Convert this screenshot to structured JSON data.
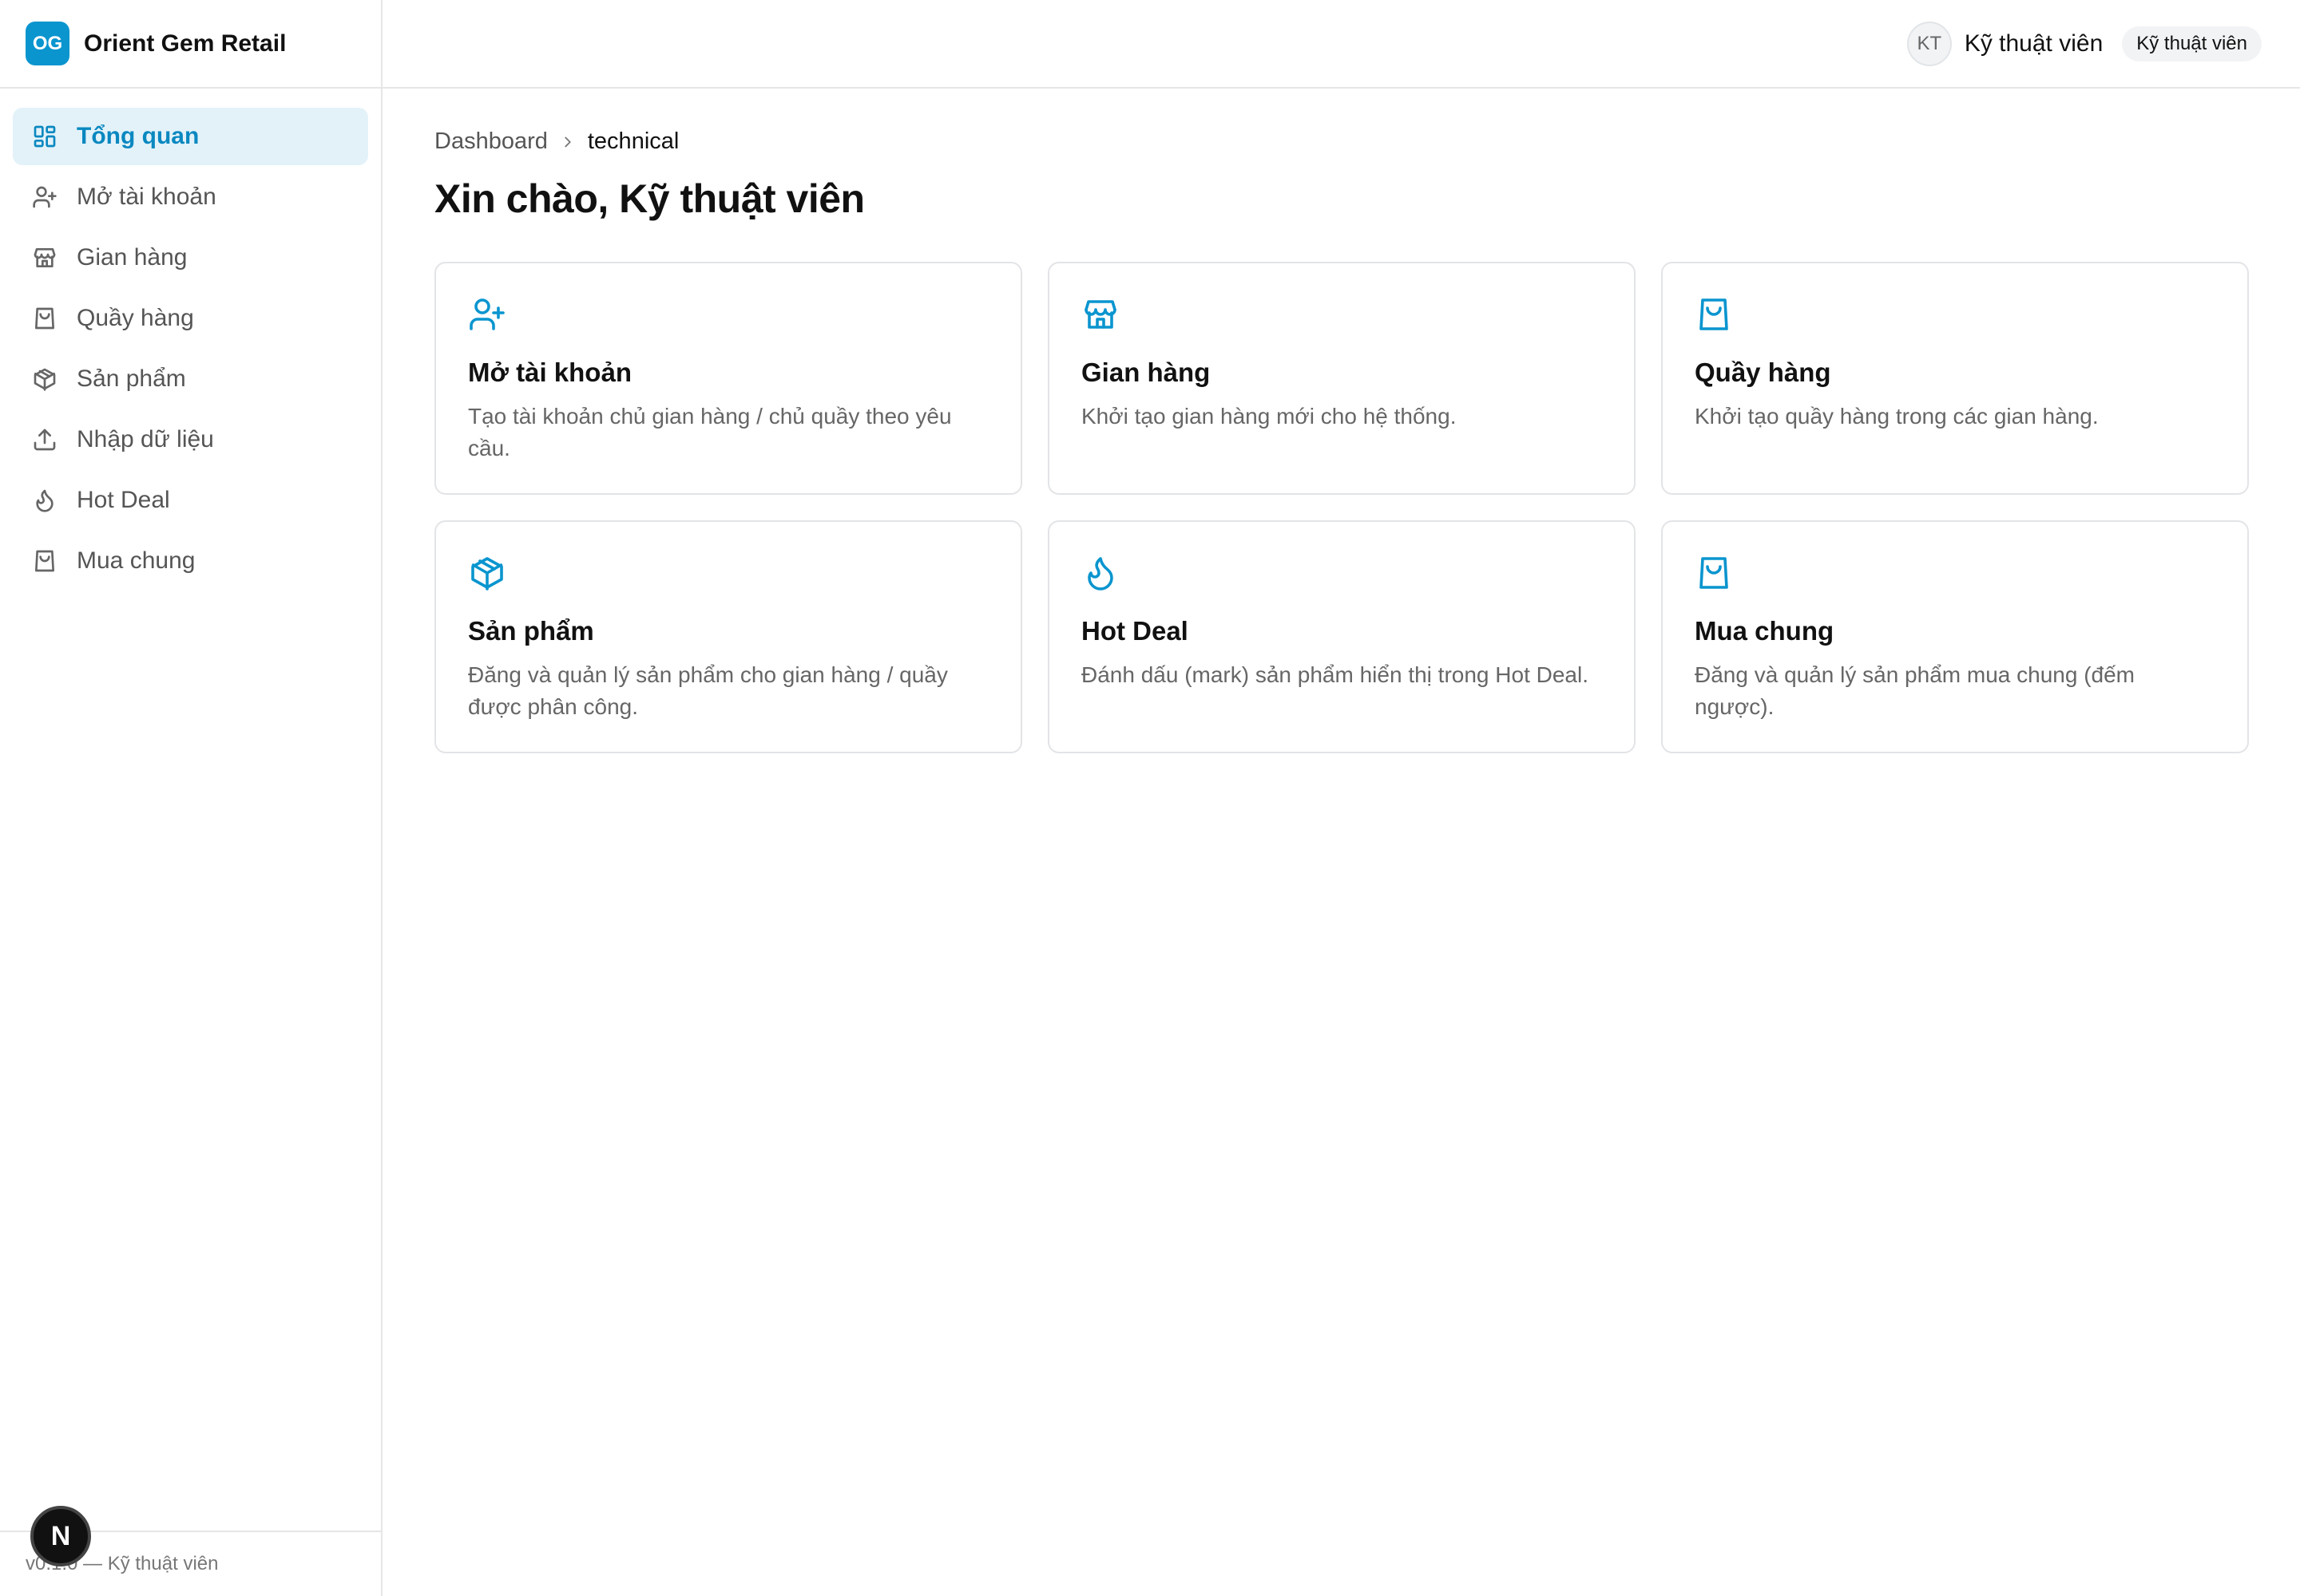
{
  "brand": {
    "logo": "OG",
    "name": "Orient Gem Retail"
  },
  "sidebar": {
    "items": [
      {
        "label": "Tổng quan",
        "icon": "dashboard-icon",
        "active": true
      },
      {
        "label": "Mở tài khoản",
        "icon": "user-plus-icon",
        "active": false
      },
      {
        "label": "Gian hàng",
        "icon": "store-icon",
        "active": false
      },
      {
        "label": "Quầy hàng",
        "icon": "shopping-bag-icon",
        "active": false
      },
      {
        "label": "Sản phẩm",
        "icon": "package-icon",
        "active": false
      },
      {
        "label": "Nhập dữ liệu",
        "icon": "upload-icon",
        "active": false
      },
      {
        "label": "Hot Deal",
        "icon": "flame-icon",
        "active": false
      },
      {
        "label": "Mua chung",
        "icon": "shopping-bag-icon",
        "active": false
      }
    ],
    "footer": "v0.1.0 — Kỹ thuật viên",
    "fab_label": "N"
  },
  "header": {
    "avatar": "KT",
    "user_name": "Kỹ thuật viên",
    "role": "Kỹ thuật viên"
  },
  "breadcrumb": {
    "root": "Dashboard",
    "current": "technical"
  },
  "page_title": "Xin chào, Kỹ thuật viên",
  "cards": [
    {
      "title": "Mở tài khoản",
      "desc": "Tạo tài khoản chủ gian hàng / chủ quầy theo yêu cầu.",
      "icon": "user-plus-icon"
    },
    {
      "title": "Gian hàng",
      "desc": "Khởi tạo gian hàng mới cho hệ thống.",
      "icon": "store-icon"
    },
    {
      "title": "Quầy hàng",
      "desc": "Khởi tạo quầy hàng trong các gian hàng.",
      "icon": "shopping-bag-icon"
    },
    {
      "title": "Sản phẩm",
      "desc": "Đăng và quản lý sản phẩm cho gian hàng / quầy được phân công.",
      "icon": "package-icon"
    },
    {
      "title": "Hot Deal",
      "desc": "Đánh dấu (mark) sản phẩm hiển thị trong Hot Deal.",
      "icon": "flame-icon"
    },
    {
      "title": "Mua chung",
      "desc": "Đăng và quản lý sản phẩm mua chung (đếm ngược).",
      "icon": "shopping-bag-icon"
    }
  ],
  "colors": {
    "accent": "#0a95cf",
    "active_bg": "#e3f2f9",
    "border": "#e2e4e7"
  }
}
